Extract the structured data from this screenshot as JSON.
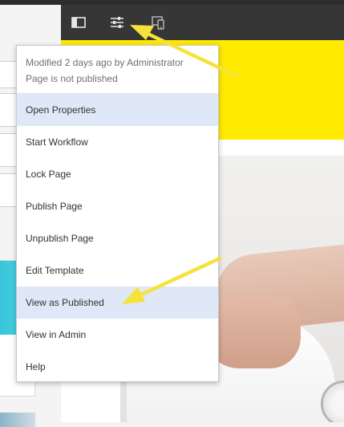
{
  "toolbar": {
    "buttons": [
      {
        "icon": "side-panel-icon"
      },
      {
        "icon": "page-properties-sliders-icon"
      },
      {
        "icon": "emulator-device-icon"
      }
    ]
  },
  "page_menu": {
    "modified_text": "Modified 2 days ago by Administrator",
    "status_text": "Page is not published",
    "items": [
      {
        "label": "Open Properties",
        "highlighted": true
      },
      {
        "label": "Start Workflow",
        "highlighted": false
      },
      {
        "label": "Lock Page",
        "highlighted": false
      },
      {
        "label": "Publish Page",
        "highlighted": false
      },
      {
        "label": "Unpublish Page",
        "highlighted": false
      },
      {
        "label": "Edit Template",
        "highlighted": false
      },
      {
        "label": "View as Published",
        "highlighted": true
      },
      {
        "label": "View in Admin",
        "highlighted": false
      },
      {
        "label": "Help",
        "highlighted": false
      }
    ]
  },
  "colors": {
    "toolbar_bg": "#363636",
    "banner_yellow": "#ffea00",
    "menu_highlight": "#dfe8f7",
    "annotation_arrow": "#f5e23a"
  }
}
